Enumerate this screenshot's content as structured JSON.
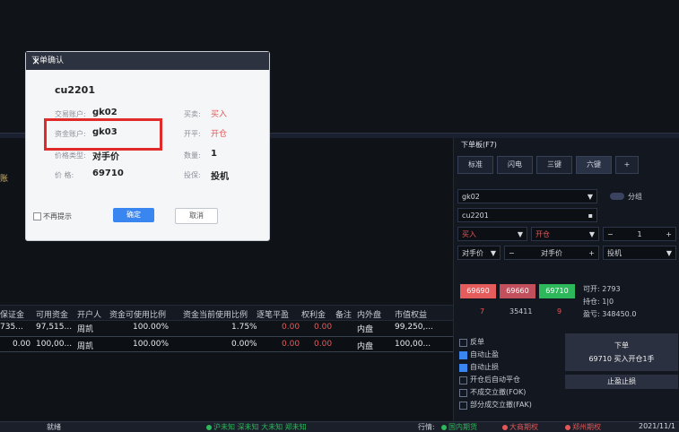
{
  "dialog": {
    "title": "下单确认",
    "close": "×",
    "product": "cu2201",
    "account_label": "交易账户:",
    "account_value": "gk02",
    "fund_label": "资金账户:",
    "fund_value": "gk03",
    "price_type_label": "价格类型:",
    "price_type_value": "对手价",
    "price_label": "价    格:",
    "price_value": "69710",
    "buysell_label": "买卖:",
    "buysell_value": "买入",
    "openclose_label": "开平:",
    "openclose_value": "开仓",
    "qty_label": "数量:",
    "qty_value": "1",
    "hedge_label": "投保:",
    "hedge_value": "投机",
    "no_remind": "不再提示",
    "ok": "确定",
    "cancel": "取消"
  },
  "left": {
    "side_label": "账",
    "headers": [
      "保证金",
      "可用资金",
      "开户人",
      "资金可使用比例",
      "资金当前使用比例",
      "逐笔平盈",
      "权利金",
      "备注",
      "内外盘",
      "市值权益"
    ],
    "rows": [
      [
        "735...",
        "97,515...",
        "周凯",
        "100.00%",
        "1.75%",
        "0.00",
        "0.00",
        "",
        "内盘",
        "99,250,..."
      ],
      [
        "0.00",
        "100,00...",
        "周凯",
        "100.00%",
        "0.00%",
        "0.00",
        "0.00",
        "",
        "内盘",
        "100,00..."
      ]
    ]
  },
  "panel": {
    "title": "下单板(F7)",
    "tabs": [
      "标准",
      "闪电",
      "三键",
      "六键",
      "+"
    ],
    "account": "gk02",
    "split_label": "分组",
    "contract": "cu2201",
    "direction": "买入",
    "offset": "开仓",
    "qty": "1",
    "price_mode": "对手价",
    "price": "对手价",
    "hedge": "投机",
    "quotes": [
      "69690",
      "69660",
      "69710"
    ],
    "vols": [
      "7",
      "35411",
      "9"
    ],
    "open_label": "可开: 2793",
    "pos_label": "持仓: 1|0",
    "margin_label": "盈亏: 348450.0",
    "options": [
      "反单",
      "自动止盈",
      "自动止损",
      "开仓后自动平仓",
      "不成交立撤(FOK)",
      "部分成交立撤(FAK)"
    ],
    "order_btn": "下单",
    "order_desc": "69710 买入开仓1手",
    "stop_btn": "止盈止损"
  },
  "status": {
    "left": "就绪",
    "middle": "沪未知 深未知 大未知 郑未知",
    "market": "行情:",
    "m1": "国内期货",
    "m2": "大商期权",
    "m3": "郑州期权",
    "date": "2021/11/1"
  },
  "colors": {
    "accent": "#3a86f0",
    "red": "#e45757",
    "highlight": "#e12b2b"
  }
}
